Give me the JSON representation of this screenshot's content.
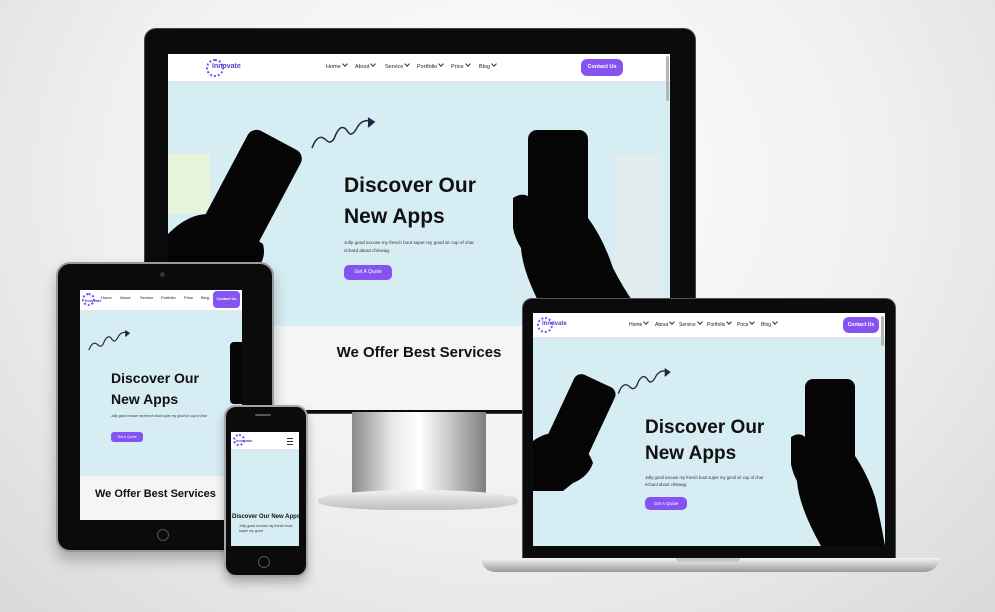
{
  "site": {
    "logo_text": "Innovate",
    "nav": [
      "Home",
      "About",
      "Service",
      "Portfolio",
      "Price",
      "Blog"
    ],
    "contact_label": "Contact Us",
    "hero_title_line1": "Discover Our",
    "hero_title_line2": "New Apps",
    "hero_title_mobile": "Discover Our New Apps",
    "hero_text_line1": "Jolly good excuse my french boot super my good sir cup of char",
    "hero_text_line2": "richard about chinwag.",
    "hero_text_mobile": "Jolly good excuse my french boot super my good",
    "quote_label": "Get A Quote",
    "services_title": "We Offer Best Services"
  },
  "colors": {
    "accent": "#8453f2",
    "hero_bg": "#d6edf4",
    "device_frame": "#0b0b0b"
  },
  "icons": [
    "menu-icon",
    "chevron-down-icon",
    "arrow-doodle-icon"
  ]
}
